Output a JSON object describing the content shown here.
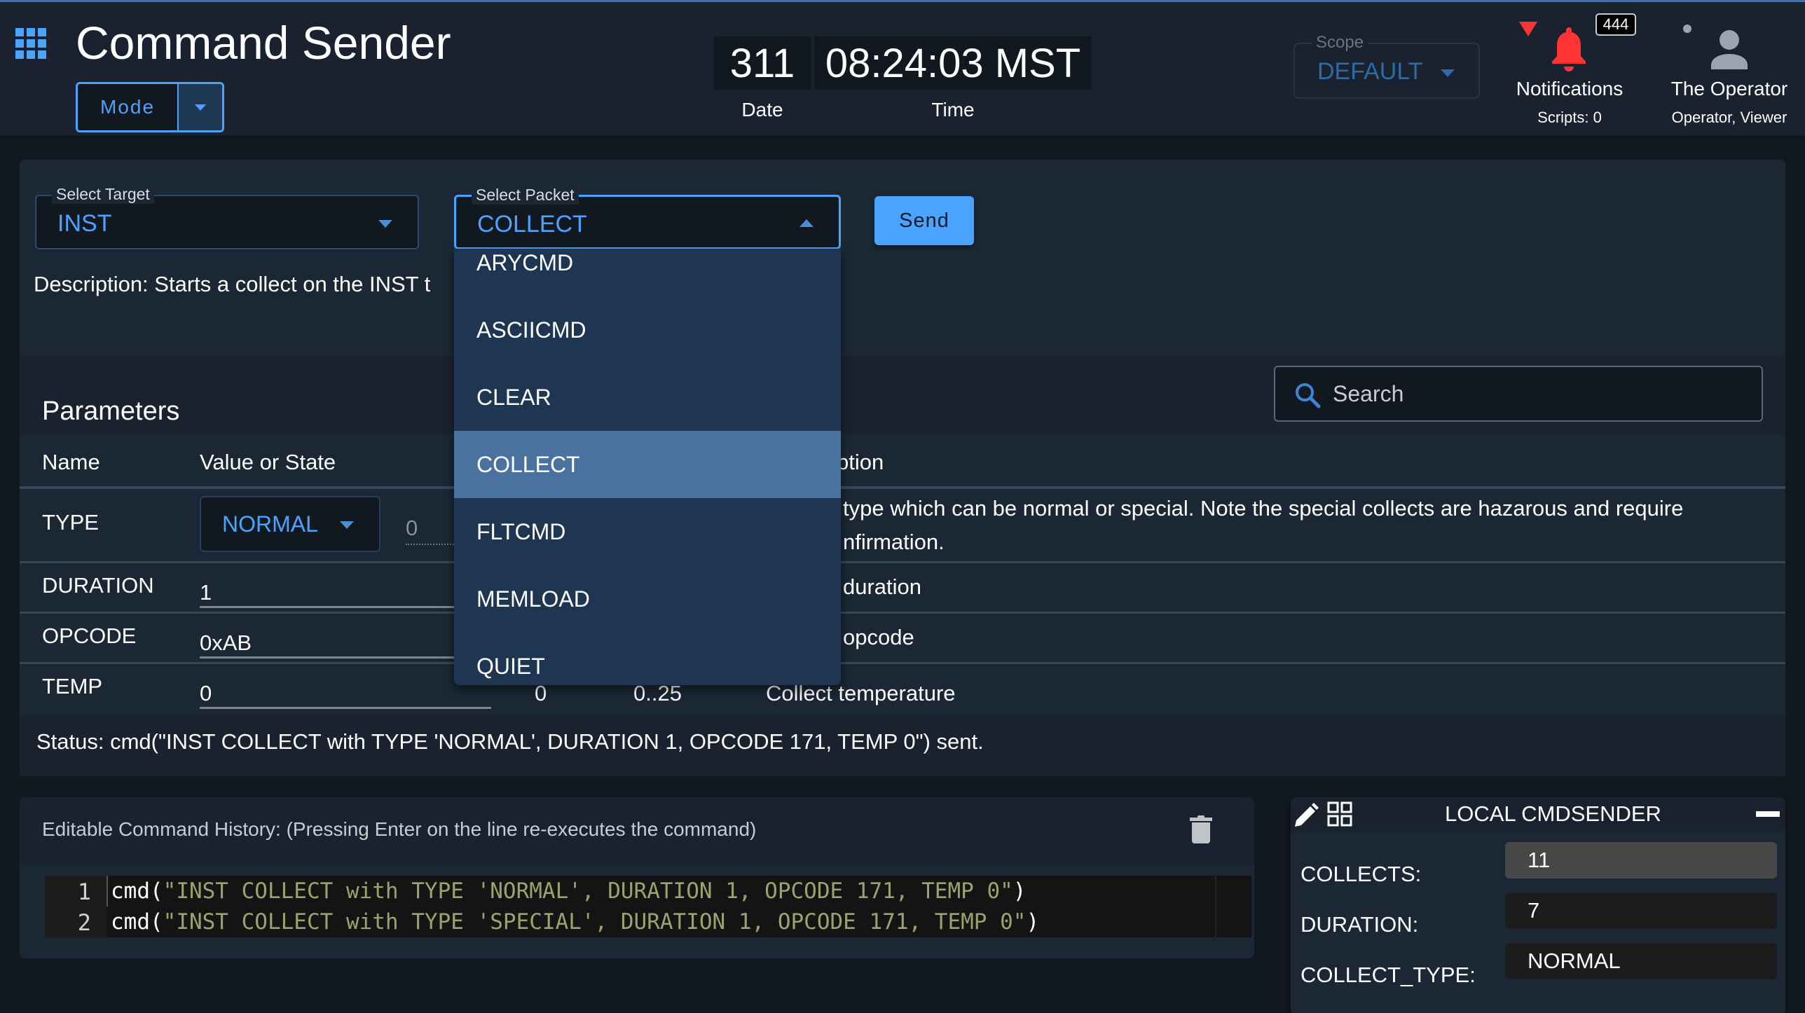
{
  "header": {
    "app_title": "Command Sender",
    "mode_label": "Mode",
    "date_value": "311",
    "date_label": "Date",
    "time_value": "08:24:03 MST",
    "time_label": "Time",
    "scope_label": "Scope",
    "scope_value": "DEFAULT",
    "notifications_badge": "444",
    "notifications_label": "Notifications",
    "scripts_label": "Scripts: 0",
    "user_name": "The Operator",
    "user_roles": "Operator, Viewer"
  },
  "command_form": {
    "target_label": "Select Target",
    "target_value": "INST",
    "packet_label": "Select Packet",
    "packet_value": "COLLECT",
    "send_label": "Send",
    "description": "Description: Starts a collect on the INST t"
  },
  "packet_dropdown": {
    "items": [
      "ARYCMD",
      "ASCIICMD",
      "CLEAR",
      "COLLECT",
      "FLTCMD",
      "MEMLOAD",
      "QUIET"
    ],
    "selected": "COLLECT"
  },
  "parameters": {
    "title": "Parameters",
    "search_placeholder": "Search",
    "columns": [
      "Name",
      "Value or State",
      "ption"
    ],
    "rows": [
      {
        "name": "TYPE",
        "value": "NORMAL",
        "state": "0",
        "description_line1": "type which can be normal or special. Note the special collects are hazarous and require",
        "description_line2": "nfirmation."
      },
      {
        "name": "DURATION",
        "value": "1",
        "description": "duration"
      },
      {
        "name": "OPCODE",
        "value": "0xAB",
        "description": "opcode"
      },
      {
        "name": "TEMP",
        "value": "0",
        "units": "0",
        "range": "0..25",
        "description": "Collect temperature"
      }
    ]
  },
  "status": "Status: cmd(\"INST COLLECT with TYPE 'NORMAL', DURATION 1, OPCODE 171, TEMP 0\") sent.",
  "history": {
    "title": "Editable Command History: (Pressing Enter on the line re-executes the command)",
    "lines": [
      {
        "num": "1",
        "fn": "cmd(",
        "str": "\"INST COLLECT with TYPE 'NORMAL', DURATION 1, OPCODE 171, TEMP 0\"",
        "close": ")"
      },
      {
        "num": "2",
        "fn": "cmd(",
        "str": "\"INST COLLECT with TYPE 'SPECIAL', DURATION 1, OPCODE 171, TEMP 0\"",
        "close": ")"
      }
    ]
  },
  "local_cmdsender": {
    "title": "LOCAL CMDSENDER",
    "rows": [
      {
        "label": "COLLECTS:",
        "value": "11"
      },
      {
        "label": "DURATION:",
        "value": "7"
      },
      {
        "label": "COLLECT_TYPE:",
        "value": "NORMAL"
      }
    ]
  },
  "colors": {
    "accent": "#4aa3ff",
    "alert": "#ff3333",
    "background": "#121820",
    "panel": "#1b2735",
    "dropdown_selected": "#4a729e"
  }
}
